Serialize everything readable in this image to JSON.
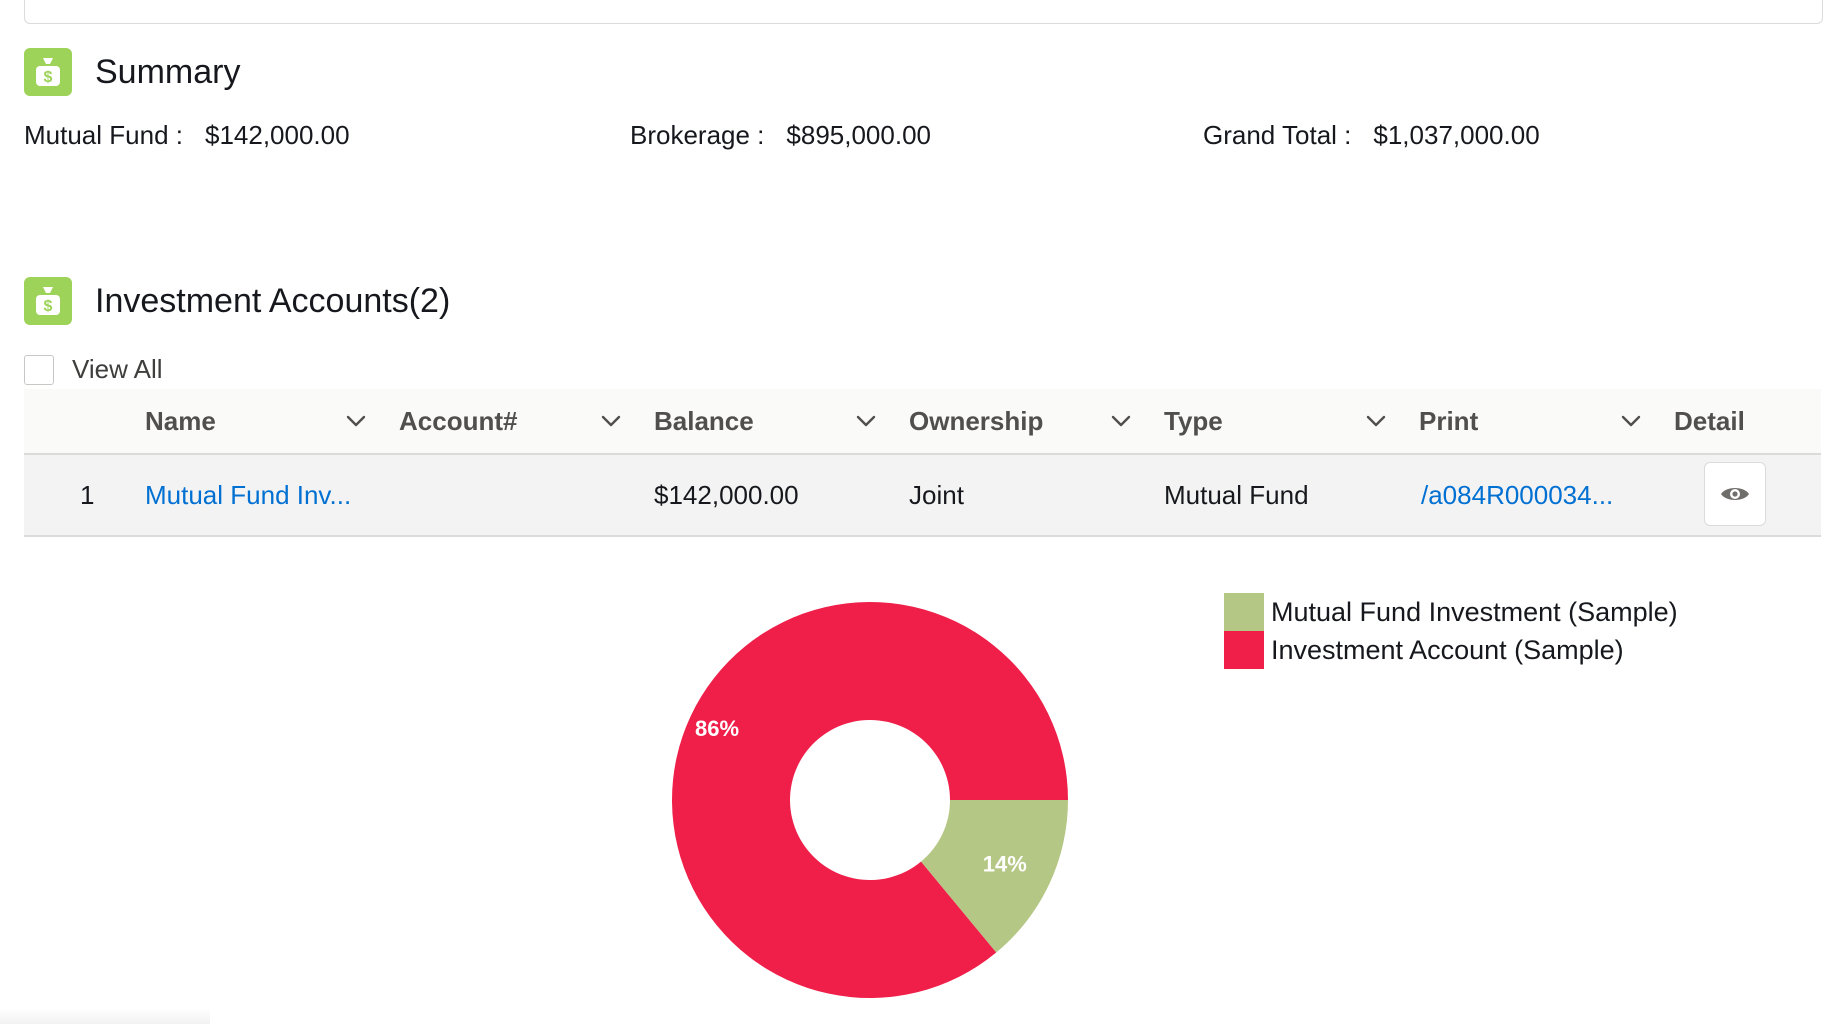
{
  "summary": {
    "title": "Summary",
    "icon": "money-bag-icon",
    "items": [
      {
        "label": "Mutual Fund :",
        "value": "$142,000.00"
      },
      {
        "label": "Brokerage :",
        "value": "$895,000.00"
      },
      {
        "label": "Grand Total :",
        "value": "$1,037,000.00"
      }
    ]
  },
  "accounts": {
    "title": "Investment Accounts(2)",
    "icon": "money-bag-icon",
    "view_all_label": "View All",
    "columns": [
      "Name",
      "Account#",
      "Balance",
      "Ownership",
      "Type",
      "Print",
      "Detail"
    ],
    "rows": [
      {
        "num": "1",
        "name": "Mutual Fund Inv...",
        "account": "",
        "balance": "$142,000.00",
        "ownership": "Joint",
        "type": "Mutual Fund",
        "print": "/a084R000034...",
        "detail_icon": "eye-icon"
      }
    ]
  },
  "colors": {
    "section_icon_bg": "#9ed35a",
    "link": "#0070d2",
    "slice_mutual_fund": "#b5c785",
    "slice_investment_account": "#ef1f4a"
  },
  "chart_data": {
    "type": "pie",
    "donut": true,
    "categories": [
      "Mutual Fund Investment (Sample)",
      "Investment Account (Sample)"
    ],
    "values": [
      14,
      86
    ],
    "labels": [
      "14%",
      "86%"
    ],
    "colors": [
      "#b5c785",
      "#ef1f4a"
    ],
    "legend_position": "right"
  }
}
